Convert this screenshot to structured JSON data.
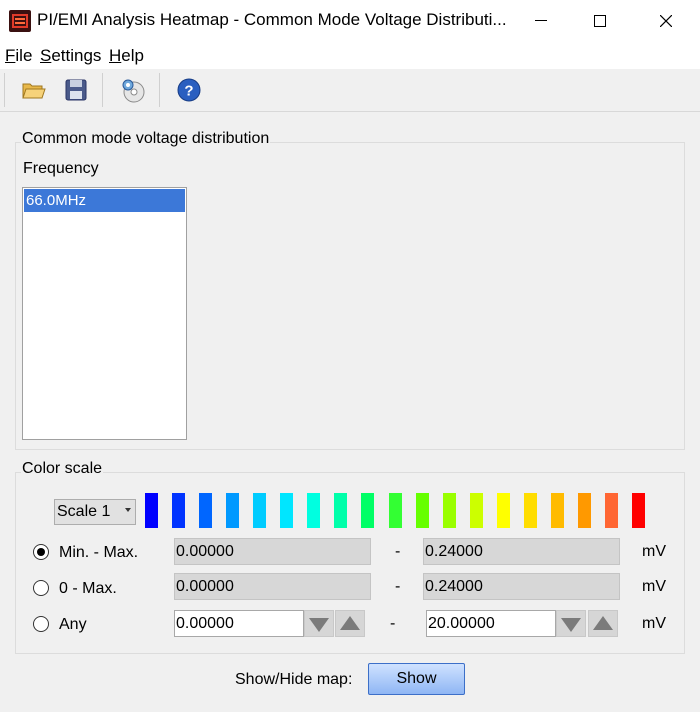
{
  "window": {
    "title": "PI/EMI Analysis Heatmap - Common Mode Voltage Distributi..."
  },
  "menu": {
    "items": [
      {
        "accel": "F",
        "rest": "ile"
      },
      {
        "accel": "S",
        "rest": "ettings"
      },
      {
        "accel": "H",
        "rest": "elp"
      }
    ]
  },
  "toolbar": {
    "icons": [
      "open-folder-icon",
      "save-icon",
      "settings-disc-icon",
      "help-icon"
    ]
  },
  "distribution": {
    "group_title": "Common mode voltage distribution",
    "frequency_label": "Frequency",
    "frequencies": [
      "66.0MHz"
    ],
    "selected_frequency": "66.0MHz"
  },
  "color_scale": {
    "group_title": "Color scale",
    "scale_select_value": "Scale 1",
    "swatch_colors": [
      "#0000ff",
      "#0033ff",
      "#0066ff",
      "#0099ff",
      "#00ccff",
      "#00e6ff",
      "#00ffe0",
      "#00ffaa",
      "#00ff66",
      "#33ff33",
      "#66ff00",
      "#99ff00",
      "#ccff00",
      "#ffff00",
      "#ffdd00",
      "#ffbb00",
      "#ff9900",
      "#ff6633",
      "#ff0000"
    ],
    "options": [
      {
        "label": "Min. - Max.",
        "min": "0.00000",
        "max": "0.24000",
        "unit": "mV",
        "selected": true,
        "editable": false
      },
      {
        "label": "0 - Max.",
        "min": "0.00000",
        "max": "0.24000",
        "unit": "mV",
        "selected": false,
        "editable": false
      },
      {
        "label": "Any",
        "min": "0.00000",
        "max": "20.00000",
        "unit": "mV",
        "selected": false,
        "editable": true
      }
    ],
    "range_separator": "-"
  },
  "footer": {
    "show_hide_label": "Show/Hide map:",
    "show_button_label": "Show"
  }
}
